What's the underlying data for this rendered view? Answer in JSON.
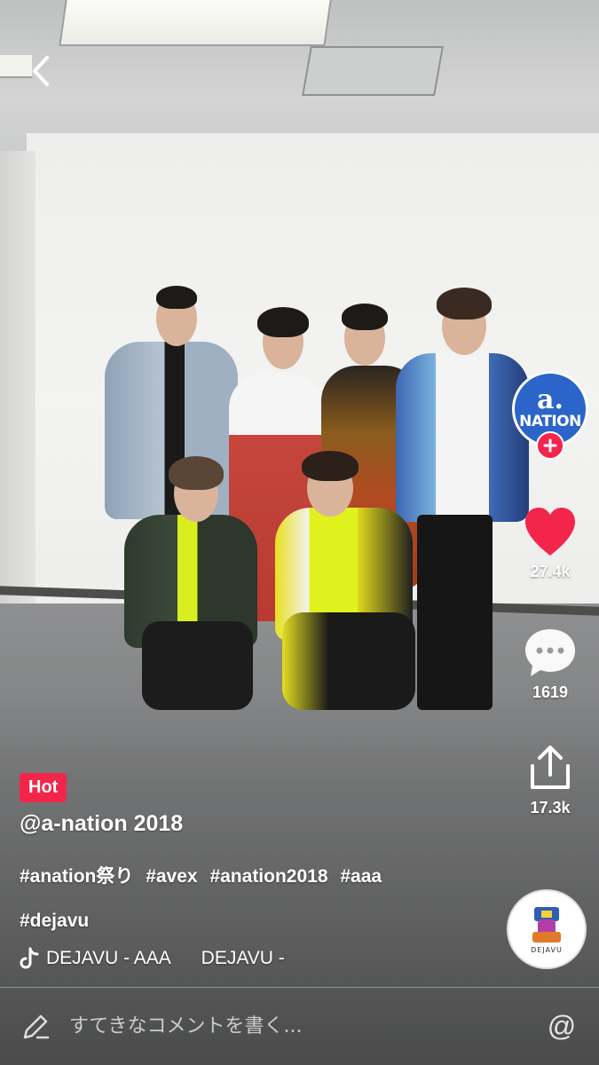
{
  "video": {
    "description_icon": "group-photo"
  },
  "nav": {
    "back_icon": "chevron-left-icon"
  },
  "creator": {
    "avatar_symbol": "a.",
    "avatar_text": "NATION",
    "avatar_color": "#2b65c9",
    "follow_icon": "plus-icon"
  },
  "actions": {
    "like_count": "27.4k",
    "comment_count": "1619",
    "share_count": "17.3k",
    "like_color": "#f4254b"
  },
  "caption": {
    "badge": "Hot",
    "username": "@a-nation 2018",
    "hashtags": [
      "#anation祭り",
      "#avex",
      "#anation2018",
      "#aaa",
      "#dejavu"
    ]
  },
  "music": {
    "track_parts": [
      "DEJAVU - AAA",
      "DEJAVU -"
    ],
    "disc_label": "DEJAVU"
  },
  "comment": {
    "placeholder": "すてきなコメントを書く..."
  },
  "colors": {
    "accent": "#f4254b"
  }
}
